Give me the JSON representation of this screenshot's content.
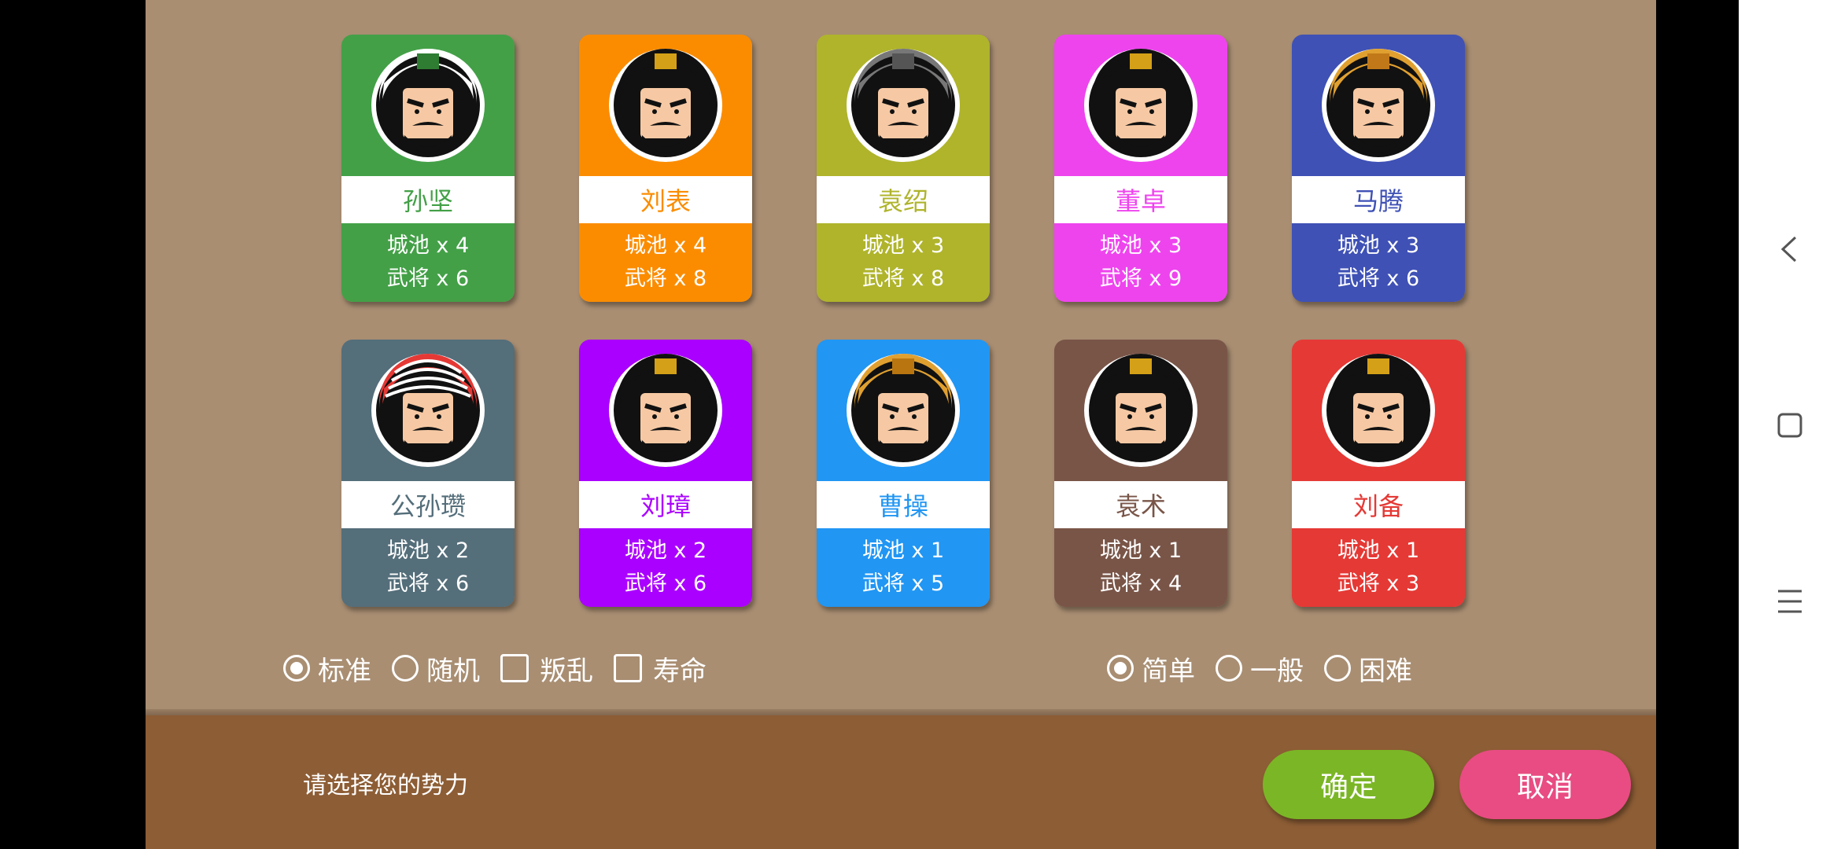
{
  "factions": [
    {
      "name": "孙坚",
      "cities": "城池 x 4",
      "generals": "武将 x 6",
      "color": "#43a047",
      "name_color": "#43a047",
      "portrait": "helmet-general-white"
    },
    {
      "name": "刘表",
      "cities": "城池 x 4",
      "generals": "武将 x 8",
      "color": "#fb8c00",
      "name_color": "#fb8c00",
      "portrait": "crown-scholar"
    },
    {
      "name": "袁绍",
      "cities": "城池 x 3",
      "generals": "武将 x 8",
      "color": "#afb42b",
      "name_color": "#afb42b",
      "portrait": "iron-helmet"
    },
    {
      "name": "董卓",
      "cities": "城池 x 3",
      "generals": "武将 x 9",
      "color": "#ee44ee",
      "name_color": "#ee44ee",
      "portrait": "gold-crown-tyrant"
    },
    {
      "name": "马腾",
      "cities": "城池 x 3",
      "generals": "武将 x 6",
      "color": "#3f51b5",
      "name_color": "#3f51b5",
      "portrait": "gold-helmet"
    },
    {
      "name": "公孙瓒",
      "cities": "城池 x 2",
      "generals": "武将 x 6",
      "color": "#546e7a",
      "name_color": "#546e7a",
      "portrait": "red-turban"
    },
    {
      "name": "刘璋",
      "cities": "城池 x 2",
      "generals": "武将 x 6",
      "color": "#aa00ff",
      "name_color": "#aa00ff",
      "portrait": "crown-lord"
    },
    {
      "name": "曹操",
      "cities": "城池 x 1",
      "generals": "武将 x 5",
      "color": "#2196f3",
      "name_color": "#2196f3",
      "portrait": "gold-cap"
    },
    {
      "name": "袁术",
      "cities": "城池 x 1",
      "generals": "武将 x 4",
      "color": "#795548",
      "name_color": "#795548",
      "portrait": "gold-crown-beard"
    },
    {
      "name": "刘备",
      "cities": "城池 x 1",
      "generals": "武将 x 3",
      "color": "#e53935",
      "name_color": "#e53935",
      "portrait": "crown-benevolent"
    }
  ],
  "modes": [
    {
      "label": "标准",
      "type": "radio",
      "checked": true
    },
    {
      "label": "随机",
      "type": "radio",
      "checked": false
    },
    {
      "label": "叛乱",
      "type": "checkbox",
      "checked": false
    },
    {
      "label": "寿命",
      "type": "checkbox",
      "checked": false
    }
  ],
  "difficulty": [
    {
      "label": "简单",
      "checked": true
    },
    {
      "label": "一般",
      "checked": false
    },
    {
      "label": "困难",
      "checked": false
    }
  ],
  "bottom": {
    "prompt": "请选择您的势力",
    "ok_label": "确定",
    "cancel_label": "取消",
    "ok_color": "#7bb626",
    "cancel_color": "#e84c82"
  },
  "background_color": "#a98e72",
  "nav_icons": [
    "back-icon",
    "recents-icon",
    "menu-icon"
  ]
}
